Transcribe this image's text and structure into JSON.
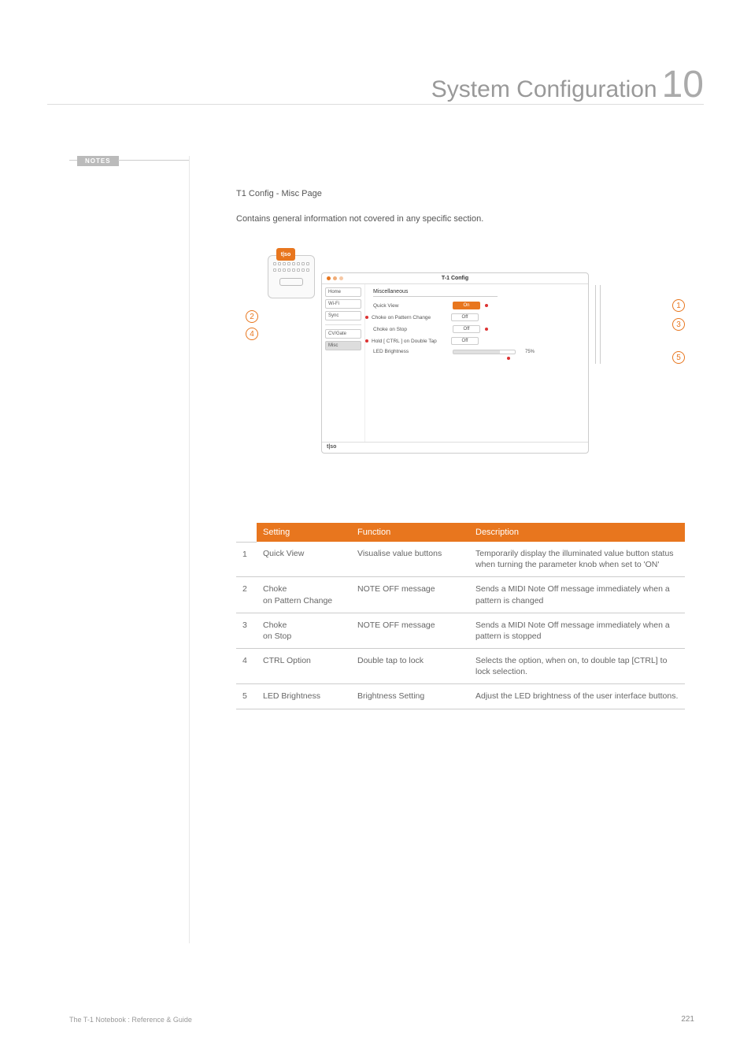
{
  "header": {
    "title": "System Configuration",
    "chapter": "10"
  },
  "notes_label": "NOTES",
  "section": {
    "title": "T1 Config - Misc Page",
    "desc": "Contains general information not covered in any specific section."
  },
  "hw_badge": "t|so",
  "window": {
    "title": "T-1 Config",
    "sidebar": [
      "Home",
      "Wi-Fi",
      "Sync",
      "CV/Gate",
      "Misc"
    ],
    "main_title": "Miscellaneous",
    "rows": [
      {
        "label": "Quick View",
        "value": "On",
        "on": true
      },
      {
        "label": "Choke on Pattern Change",
        "value": "Off"
      },
      {
        "label": "Choke on Stop",
        "value": "Off"
      },
      {
        "label": "Hold [ CTRL ] on Double Tap",
        "value": "Off"
      },
      {
        "label": "LED Brightness",
        "slider": true,
        "pct": "75%"
      }
    ],
    "footer": "t|so"
  },
  "callouts": {
    "c1": "1",
    "c2": "2",
    "c3": "3",
    "c4": "4",
    "c5": "5"
  },
  "table": {
    "headers": {
      "setting": "Setting",
      "function": "Function",
      "description": "Description"
    },
    "rows": [
      {
        "n": "1",
        "setting": "Quick View",
        "function": "Visualise value buttons",
        "description": "Temporarily display the illuminated value button status when turning the parameter knob when set to 'ON'"
      },
      {
        "n": "2",
        "setting": "Choke\non Pattern Change",
        "function": "NOTE OFF message",
        "description": "Sends a MIDI Note Off message immediately when a pattern is changed"
      },
      {
        "n": "3",
        "setting": "Choke\non Stop",
        "function": "NOTE OFF message",
        "description": "Sends a MIDI Note Off message immediately when a pattern is stopped"
      },
      {
        "n": "4",
        "setting": "CTRL Option",
        "function": "Double tap to lock",
        "description": "Selects the option, when on, to double tap [CTRL] to lock selection."
      },
      {
        "n": "5",
        "setting": "LED Brightness",
        "function": "Brightness Setting",
        "description": "Adjust the LED brightness of the user interface buttons."
      }
    ]
  },
  "footer": {
    "left": "The T-1 Notebook : Reference & Guide",
    "right": "221"
  },
  "chart_data": {
    "type": "table",
    "title": "T1 Config - Misc Page settings",
    "columns": [
      "#",
      "Setting",
      "Function",
      "Description"
    ],
    "rows": [
      [
        "1",
        "Quick View",
        "Visualise value buttons",
        "Temporarily display the illuminated value button status when turning the parameter knob when set to 'ON'"
      ],
      [
        "2",
        "Choke on Pattern Change",
        "NOTE OFF message",
        "Sends a MIDI Note Off message immediately when a pattern is changed"
      ],
      [
        "3",
        "Choke on Stop",
        "NOTE OFF message",
        "Sends a MIDI Note Off message immediately when a pattern is stopped"
      ],
      [
        "4",
        "CTRL Option",
        "Double tap to lock",
        "Selects the option, when on, to double tap [CTRL] to lock selection."
      ],
      [
        "5",
        "LED Brightness",
        "Brightness Setting",
        "Adjust the LED brightness of the user interface buttons."
      ]
    ]
  }
}
